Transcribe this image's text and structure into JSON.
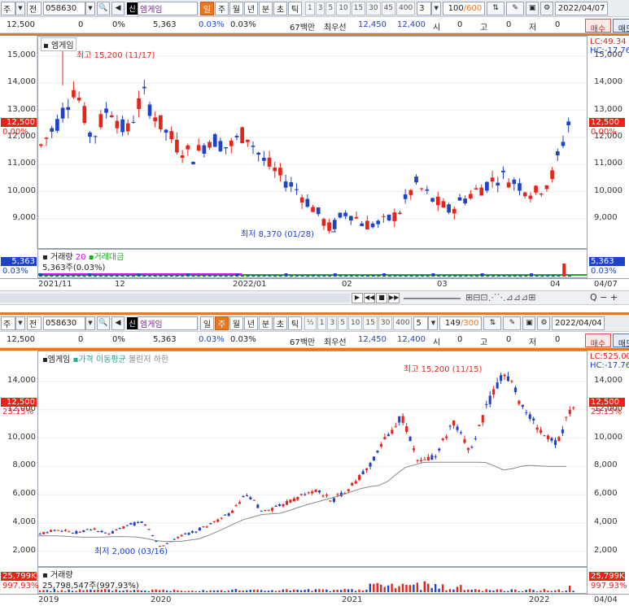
{
  "top": {
    "toolbar": {
      "market_type": "주",
      "jeon_label": "전",
      "code": "058630",
      "sin_badge": "신",
      "stock_name": "엠게임",
      "periods": [
        "일",
        "주",
        "월",
        "년",
        "분",
        "초",
        "틱"
      ],
      "active_period": "일",
      "nums": [
        "1",
        "3",
        "5",
        "10",
        "15",
        "30",
        "45",
        "400"
      ],
      "n_value": "3",
      "count_value": "100",
      "count_total": "/600",
      "date": "2022/04/07"
    },
    "info": {
      "price": "12,500",
      "change": "0",
      "change_pct": "0%",
      "volume": "5,363",
      "pct1": "0.03%",
      "pct2": "0.03%",
      "amount": "67백만",
      "best_label": "최우선",
      "ask": "12,450",
      "bid": "12,400",
      "si_label": "시",
      "si": "0",
      "go_label": "고",
      "go": "0",
      "jeo_label": "저",
      "jeo": "0",
      "buy_label": "매수",
      "sell_label": "매도"
    },
    "chart": {
      "legend": "엠게임",
      "y_ticks": [
        "15,000",
        "14,000",
        "13,000",
        "12,000",
        "11,000",
        "10,000",
        "9,000"
      ],
      "cur_price_tag": "12,500",
      "cur_pct_tag": "0.00%",
      "lc_label": "LC:49.34",
      "hc_label": "HC:-17.76",
      "high_label": "최고 15,200 (11/17)",
      "low_label": "최저 8,370 (01/28)",
      "vol_legend_label": "거래량",
      "vol_legend_value": "20",
      "vol_legend_label2": "거래대금",
      "vol_text": "5,363주(0.03%)",
      "vol_tag": "5,363",
      "vol_pct_tag": "0.03%",
      "x_labels": [
        "2021/11",
        "12",
        "2022/01",
        "02",
        "03",
        "04",
        "04/07"
      ]
    }
  },
  "bottom": {
    "toolbar": {
      "market_type": "주",
      "jeon_label": "전",
      "code": "058630",
      "sin_badge": "신",
      "stock_name": "엠게임",
      "periods": [
        "일",
        "주",
        "월",
        "년",
        "분",
        "초",
        "틱"
      ],
      "active_period": "주",
      "half": "½",
      "nums": [
        "1",
        "3",
        "5",
        "10",
        "15",
        "30",
        "400"
      ],
      "n_value": "5",
      "count_value": "149",
      "count_total": "/300",
      "date": "2022/04/04"
    },
    "info": {
      "price": "12,500",
      "change": "0",
      "change_pct": "0%",
      "volume": "5,363",
      "pct1": "0.03%",
      "pct2": "0.03%",
      "amount": "67백만",
      "best_label": "최우선",
      "ask": "12,450",
      "bid": "12,400",
      "si_label": "시",
      "si": "0",
      "go_label": "고",
      "go": "0",
      "jeo_label": "저",
      "jeo": "0",
      "buy_label": "매수",
      "sell_label": "매도"
    },
    "chart": {
      "legend_name": "엠게임",
      "legend_ma": "가격 이동평균",
      "legend_bb": "볼린저 하한",
      "y_ticks": [
        "14,000",
        "12,000",
        "10,000",
        "8,000",
        "6,000",
        "4,000",
        "2,000"
      ],
      "cur_price_tag": "12,500",
      "cur_pct_tag": "23.15%",
      "lc_label": "LC:525.00",
      "hc_label": "HC:-17.76",
      "high_label": "최고 15,200 (11/15)",
      "low_label": "최저 2,000 (03/16)",
      "vol_legend_label": "거래량",
      "vol_text": "25,798,547주(997.93%)",
      "vol_tag": "25,799K",
      "vol_pct_tag": "997.93%",
      "x_labels": [
        "2019",
        "2020",
        "2021",
        "2022",
        "04/04"
      ]
    }
  },
  "colors": {
    "up": "#e8231a",
    "down": "#1e43c8",
    "accent": "#e87722",
    "ma": "#888888"
  }
}
